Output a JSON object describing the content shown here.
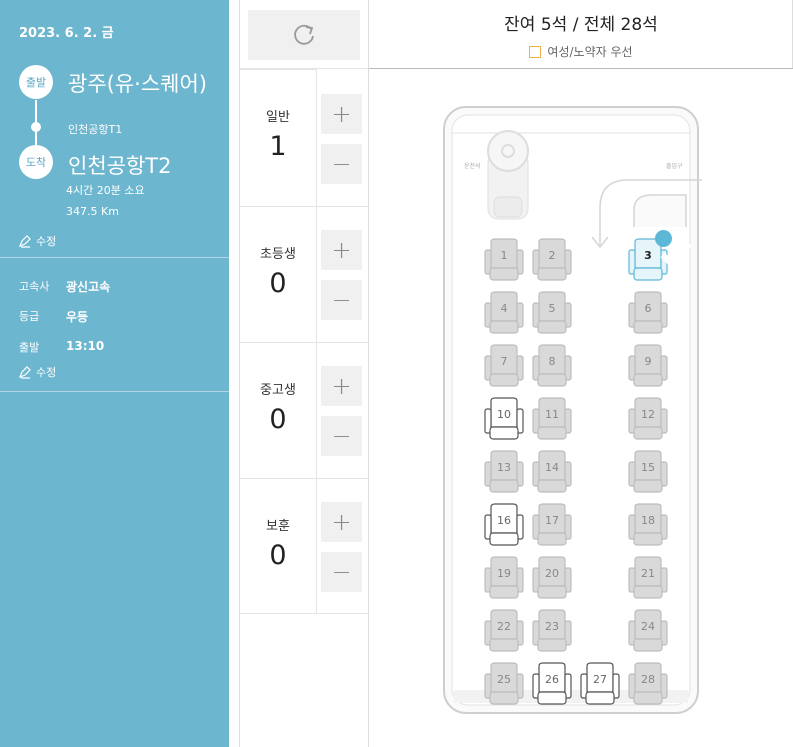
{
  "trip": {
    "date": "2023. 6. 2. 금",
    "departure_badge": "출발",
    "departure": "광주(유·스퀘어)",
    "via": "인천공항T1",
    "arrival_badge": "도착",
    "arrival": "인천공항T2",
    "duration": "4시간 20분 소요",
    "distance": "347.5 Km",
    "edit_label": "수정"
  },
  "bus_info": {
    "company_label": "고속사",
    "company": "광신고속",
    "grade_label": "등급",
    "grade": "우등",
    "time_label": "출발",
    "time": "13:10",
    "edit_label": "수정"
  },
  "passengers": [
    {
      "label": "일반",
      "count": "1"
    },
    {
      "label": "초등생",
      "count": "0"
    },
    {
      "label": "중고생",
      "count": "0"
    },
    {
      "label": "보훈",
      "count": "0"
    }
  ],
  "buttons": {
    "plus": "+",
    "minus": "−"
  },
  "seat_summary": "잔여 5석 / 전체 28석",
  "legend": "여성/노약자 우선",
  "bus_labels": {
    "driver": "운전석",
    "door": "출입구"
  },
  "seats": [
    {
      "n": "1",
      "state": "taken"
    },
    {
      "n": "2",
      "state": "taken"
    },
    {
      "n": "3",
      "state": "selected"
    },
    {
      "n": "4",
      "state": "taken"
    },
    {
      "n": "5",
      "state": "taken"
    },
    {
      "n": "6",
      "state": "taken"
    },
    {
      "n": "7",
      "state": "taken"
    },
    {
      "n": "8",
      "state": "taken"
    },
    {
      "n": "9",
      "state": "taken"
    },
    {
      "n": "10",
      "state": "available"
    },
    {
      "n": "11",
      "state": "taken"
    },
    {
      "n": "12",
      "state": "taken"
    },
    {
      "n": "13",
      "state": "taken"
    },
    {
      "n": "14",
      "state": "taken"
    },
    {
      "n": "15",
      "state": "taken"
    },
    {
      "n": "16",
      "state": "available"
    },
    {
      "n": "17",
      "state": "taken"
    },
    {
      "n": "18",
      "state": "taken"
    },
    {
      "n": "19",
      "state": "taken"
    },
    {
      "n": "20",
      "state": "taken"
    },
    {
      "n": "21",
      "state": "taken"
    },
    {
      "n": "22",
      "state": "taken"
    },
    {
      "n": "23",
      "state": "taken"
    },
    {
      "n": "24",
      "state": "taken"
    },
    {
      "n": "25",
      "state": "taken"
    },
    {
      "n": "26",
      "state": "available"
    },
    {
      "n": "27",
      "state": "available"
    },
    {
      "n": "28",
      "state": "taken"
    }
  ],
  "colors": {
    "sidebar": "#6db6cf",
    "selected": "#5cb8d6",
    "priority": "#f0b24a"
  }
}
